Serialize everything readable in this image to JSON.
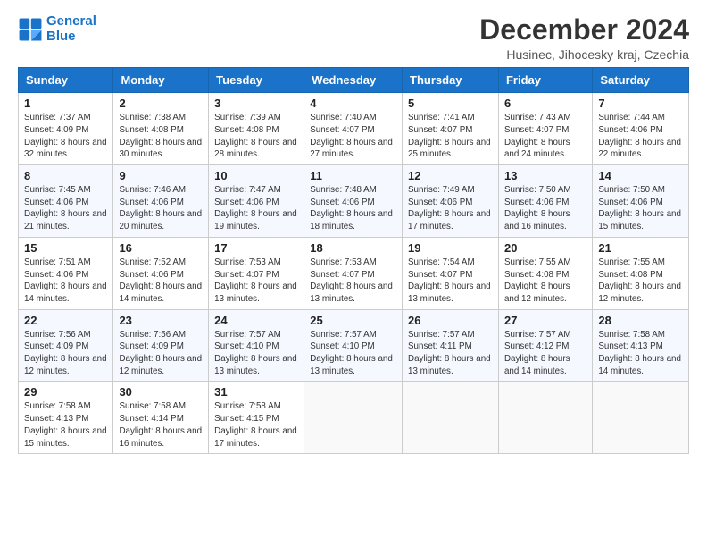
{
  "logo": {
    "line1": "General",
    "line2": "Blue"
  },
  "title": "December 2024",
  "location": "Husinec, Jihocesky kraj, Czechia",
  "days_header": [
    "Sunday",
    "Monday",
    "Tuesday",
    "Wednesday",
    "Thursday",
    "Friday",
    "Saturday"
  ],
  "weeks": [
    [
      {
        "day": "1",
        "sunrise": "Sunrise: 7:37 AM",
        "sunset": "Sunset: 4:09 PM",
        "daylight": "Daylight: 8 hours and 32 minutes."
      },
      {
        "day": "2",
        "sunrise": "Sunrise: 7:38 AM",
        "sunset": "Sunset: 4:08 PM",
        "daylight": "Daylight: 8 hours and 30 minutes."
      },
      {
        "day": "3",
        "sunrise": "Sunrise: 7:39 AM",
        "sunset": "Sunset: 4:08 PM",
        "daylight": "Daylight: 8 hours and 28 minutes."
      },
      {
        "day": "4",
        "sunrise": "Sunrise: 7:40 AM",
        "sunset": "Sunset: 4:07 PM",
        "daylight": "Daylight: 8 hours and 27 minutes."
      },
      {
        "day": "5",
        "sunrise": "Sunrise: 7:41 AM",
        "sunset": "Sunset: 4:07 PM",
        "daylight": "Daylight: 8 hours and 25 minutes."
      },
      {
        "day": "6",
        "sunrise": "Sunrise: 7:43 AM",
        "sunset": "Sunset: 4:07 PM",
        "daylight": "Daylight: 8 hours and 24 minutes."
      },
      {
        "day": "7",
        "sunrise": "Sunrise: 7:44 AM",
        "sunset": "Sunset: 4:06 PM",
        "daylight": "Daylight: 8 hours and 22 minutes."
      }
    ],
    [
      {
        "day": "8",
        "sunrise": "Sunrise: 7:45 AM",
        "sunset": "Sunset: 4:06 PM",
        "daylight": "Daylight: 8 hours and 21 minutes."
      },
      {
        "day": "9",
        "sunrise": "Sunrise: 7:46 AM",
        "sunset": "Sunset: 4:06 PM",
        "daylight": "Daylight: 8 hours and 20 minutes."
      },
      {
        "day": "10",
        "sunrise": "Sunrise: 7:47 AM",
        "sunset": "Sunset: 4:06 PM",
        "daylight": "Daylight: 8 hours and 19 minutes."
      },
      {
        "day": "11",
        "sunrise": "Sunrise: 7:48 AM",
        "sunset": "Sunset: 4:06 PM",
        "daylight": "Daylight: 8 hours and 18 minutes."
      },
      {
        "day": "12",
        "sunrise": "Sunrise: 7:49 AM",
        "sunset": "Sunset: 4:06 PM",
        "daylight": "Daylight: 8 hours and 17 minutes."
      },
      {
        "day": "13",
        "sunrise": "Sunrise: 7:50 AM",
        "sunset": "Sunset: 4:06 PM",
        "daylight": "Daylight: 8 hours and 16 minutes."
      },
      {
        "day": "14",
        "sunrise": "Sunrise: 7:50 AM",
        "sunset": "Sunset: 4:06 PM",
        "daylight": "Daylight: 8 hours and 15 minutes."
      }
    ],
    [
      {
        "day": "15",
        "sunrise": "Sunrise: 7:51 AM",
        "sunset": "Sunset: 4:06 PM",
        "daylight": "Daylight: 8 hours and 14 minutes."
      },
      {
        "day": "16",
        "sunrise": "Sunrise: 7:52 AM",
        "sunset": "Sunset: 4:06 PM",
        "daylight": "Daylight: 8 hours and 14 minutes."
      },
      {
        "day": "17",
        "sunrise": "Sunrise: 7:53 AM",
        "sunset": "Sunset: 4:07 PM",
        "daylight": "Daylight: 8 hours and 13 minutes."
      },
      {
        "day": "18",
        "sunrise": "Sunrise: 7:53 AM",
        "sunset": "Sunset: 4:07 PM",
        "daylight": "Daylight: 8 hours and 13 minutes."
      },
      {
        "day": "19",
        "sunrise": "Sunrise: 7:54 AM",
        "sunset": "Sunset: 4:07 PM",
        "daylight": "Daylight: 8 hours and 13 minutes."
      },
      {
        "day": "20",
        "sunrise": "Sunrise: 7:55 AM",
        "sunset": "Sunset: 4:08 PM",
        "daylight": "Daylight: 8 hours and 12 minutes."
      },
      {
        "day": "21",
        "sunrise": "Sunrise: 7:55 AM",
        "sunset": "Sunset: 4:08 PM",
        "daylight": "Daylight: 8 hours and 12 minutes."
      }
    ],
    [
      {
        "day": "22",
        "sunrise": "Sunrise: 7:56 AM",
        "sunset": "Sunset: 4:09 PM",
        "daylight": "Daylight: 8 hours and 12 minutes."
      },
      {
        "day": "23",
        "sunrise": "Sunrise: 7:56 AM",
        "sunset": "Sunset: 4:09 PM",
        "daylight": "Daylight: 8 hours and 12 minutes."
      },
      {
        "day": "24",
        "sunrise": "Sunrise: 7:57 AM",
        "sunset": "Sunset: 4:10 PM",
        "daylight": "Daylight: 8 hours and 13 minutes."
      },
      {
        "day": "25",
        "sunrise": "Sunrise: 7:57 AM",
        "sunset": "Sunset: 4:10 PM",
        "daylight": "Daylight: 8 hours and 13 minutes."
      },
      {
        "day": "26",
        "sunrise": "Sunrise: 7:57 AM",
        "sunset": "Sunset: 4:11 PM",
        "daylight": "Daylight: 8 hours and 13 minutes."
      },
      {
        "day": "27",
        "sunrise": "Sunrise: 7:57 AM",
        "sunset": "Sunset: 4:12 PM",
        "daylight": "Daylight: 8 hours and 14 minutes."
      },
      {
        "day": "28",
        "sunrise": "Sunrise: 7:58 AM",
        "sunset": "Sunset: 4:13 PM",
        "daylight": "Daylight: 8 hours and 14 minutes."
      }
    ],
    [
      {
        "day": "29",
        "sunrise": "Sunrise: 7:58 AM",
        "sunset": "Sunset: 4:13 PM",
        "daylight": "Daylight: 8 hours and 15 minutes."
      },
      {
        "day": "30",
        "sunrise": "Sunrise: 7:58 AM",
        "sunset": "Sunset: 4:14 PM",
        "daylight": "Daylight: 8 hours and 16 minutes."
      },
      {
        "day": "31",
        "sunrise": "Sunrise: 7:58 AM",
        "sunset": "Sunset: 4:15 PM",
        "daylight": "Daylight: 8 hours and 17 minutes."
      },
      null,
      null,
      null,
      null
    ]
  ]
}
